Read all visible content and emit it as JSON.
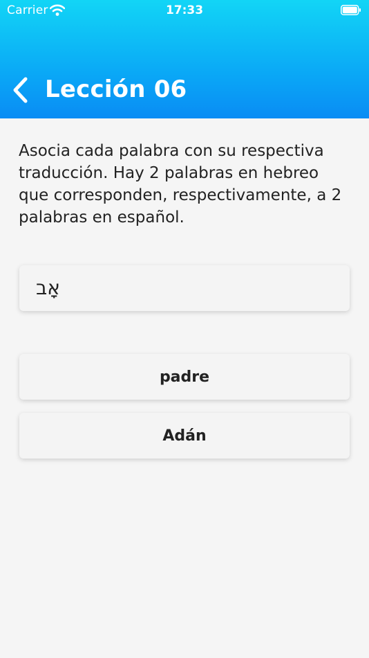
{
  "status_bar": {
    "carrier": "Carrier",
    "time": "17:33"
  },
  "header": {
    "title": "Lección 06"
  },
  "instructions": "Asocia cada palabra con su respectiva traducción. Hay 2 palabras en hebreo que corresponden, respectivamente, a 2 palabras en español.",
  "hebrew_word": "אָב",
  "answers": [
    "padre",
    "Adán"
  ],
  "colors": {
    "header_top": "#12d5f6",
    "header_bottom": "#0a8cf4",
    "background": "#f5f5f5",
    "text": "#222222"
  }
}
